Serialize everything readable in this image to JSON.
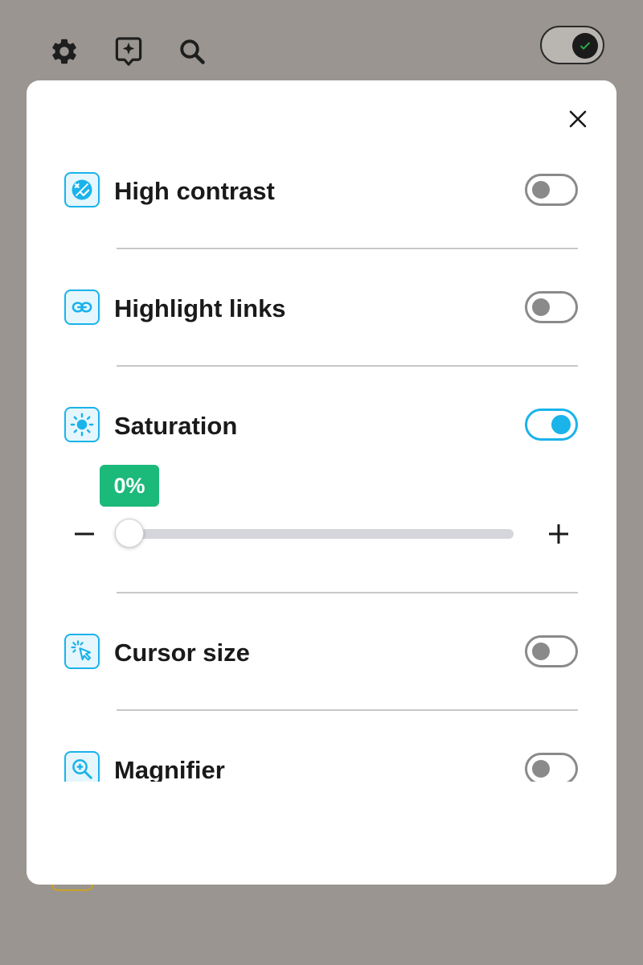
{
  "colors": {
    "accent": "#1ab3ea",
    "badge": "#1bb97a",
    "toggle_off": "#8a8a8a",
    "backdrop": "#9a9590"
  },
  "toolbar": {
    "icons": [
      "gear-icon",
      "sparkle-pin-icon",
      "search-icon"
    ],
    "dark_mode_toggle": {
      "state": "on",
      "icon": "check-icon"
    }
  },
  "panel": {
    "close_icon": "close-icon",
    "features": [
      {
        "label": "High contrast",
        "icon": "contrast-icon",
        "enabled": false
      },
      {
        "label": "Highlight links",
        "icon": "link-icon",
        "enabled": false
      },
      {
        "label": "Saturation",
        "icon": "brightness-icon",
        "enabled": true
      },
      {
        "label": "Cursor size",
        "icon": "cursor-icon",
        "enabled": false
      },
      {
        "label": "Magnifier",
        "icon": "zoom-in-icon",
        "enabled": false
      }
    ],
    "saturation": {
      "value_label": "0%",
      "value": 0,
      "min": 0,
      "max": 100,
      "decrease_icon": "minus-icon",
      "increase_icon": "plus-icon"
    }
  }
}
